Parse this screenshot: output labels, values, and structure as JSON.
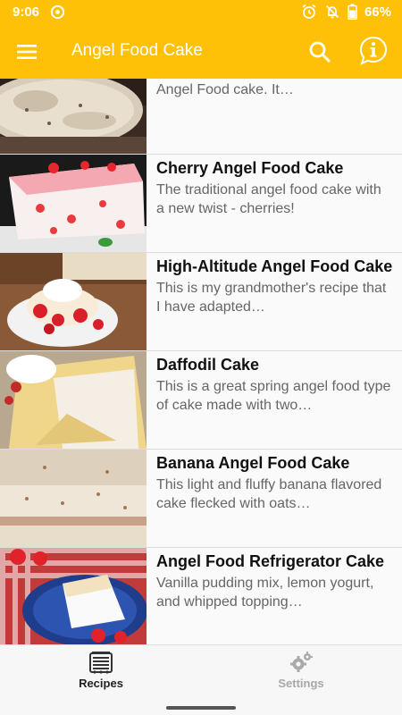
{
  "status_bar": {
    "time": "9:06",
    "battery": "66%"
  },
  "app_bar": {
    "title": "Angel Food Cake",
    "icons": [
      "menu-icon",
      "search-icon",
      "info-icon"
    ]
  },
  "recipes": [
    {
      "title": "",
      "description": "This is a yummy change to standard Angel Food cake. It…"
    },
    {
      "title": "Cherry Angel Food Cake",
      "description": "The traditional angel food cake with a new twist - cherries!"
    },
    {
      "title": "High-Altitude Angel Food Cake",
      "description": "This is my grandmother's recipe that I have adapted…"
    },
    {
      "title": "Daffodil Cake",
      "description": "This is a great spring angel food type of cake made with two…"
    },
    {
      "title": "Banana Angel Food Cake",
      "description": "This light and fluffy banana flavored cake flecked with oats…"
    },
    {
      "title": "Angel Food Refrigerator Cake",
      "description": "Vanilla pudding mix, lemon yogurt, and whipped topping…"
    }
  ],
  "bottom_nav": {
    "recipes_label": "Recipes",
    "settings_label": "Settings",
    "selected": "Recipes"
  },
  "colors": {
    "accent": "#ffc107",
    "title_text": "#111111",
    "desc_text": "#666666",
    "nav_active": "#222222",
    "nav_inactive": "#a8a8a8"
  }
}
